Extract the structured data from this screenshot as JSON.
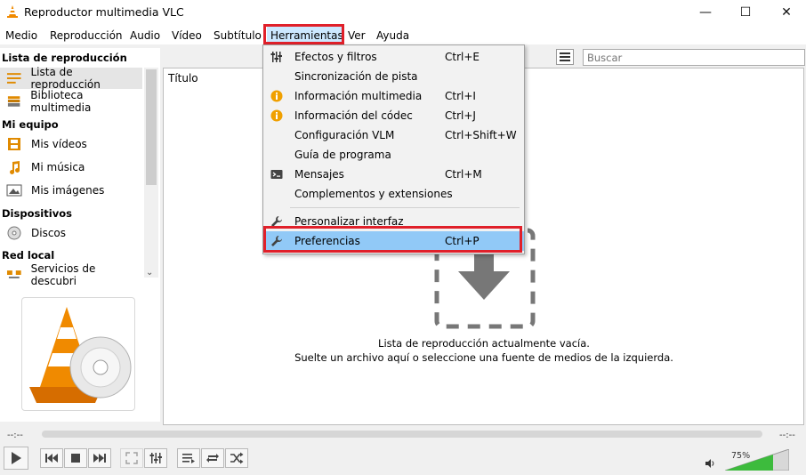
{
  "window": {
    "title": "Reproductor multimedia VLC",
    "minimize": "—",
    "maximize": "☐",
    "close": "✕"
  },
  "menubar": {
    "items": [
      "Medio",
      "Reproducción",
      "Audio",
      "Vídeo",
      "Subtítulo",
      "Herramientas",
      "Ver",
      "Ayuda"
    ],
    "active": "Herramientas"
  },
  "tools_menu": {
    "items": [
      {
        "label": "Efectos y filtros",
        "shortcut": "Ctrl+E",
        "icon": "sliders-icon"
      },
      {
        "label": "Sincronización de pista",
        "shortcut": "",
        "icon": ""
      },
      {
        "label": "Información multimedia",
        "shortcut": "Ctrl+I",
        "icon": "info-icon"
      },
      {
        "label": "Información del códec",
        "shortcut": "Ctrl+J",
        "icon": "info-icon"
      },
      {
        "label": "Configuración VLM",
        "shortcut": "Ctrl+Shift+W",
        "icon": ""
      },
      {
        "label": "Guía de programa",
        "shortcut": "",
        "icon": ""
      },
      {
        "label": "Mensajes",
        "shortcut": "Ctrl+M",
        "icon": "terminal-icon"
      },
      {
        "label": "Complementos y extensiones",
        "shortcut": "",
        "icon": ""
      },
      {
        "label": "Personalizar interfaz",
        "shortcut": "",
        "icon": "wrench-icon"
      },
      {
        "label": "Preferencias",
        "shortcut": "Ctrl+P",
        "icon": "wrench-icon"
      }
    ],
    "highlighted": "Preferencias"
  },
  "sidebar": {
    "sections": [
      {
        "header": "Lista de reproducción",
        "items": [
          "Lista de reproducción",
          "Biblioteca multimedia"
        ]
      },
      {
        "header": "Mi equipo",
        "items": [
          "Mis vídeos",
          "Mi música",
          "Mis imágenes"
        ]
      },
      {
        "header": "Dispositivos",
        "items": [
          "Discos"
        ]
      },
      {
        "header": "Red local",
        "items": [
          "Servicios de descubri"
        ]
      }
    ],
    "selected": "Lista de reproducción"
  },
  "playlist": {
    "column_title": "Título",
    "search_placeholder": "Buscar",
    "empty_line1": "Lista de reproducción actualmente vacía.",
    "empty_line2": "Suelte un archivo aquí o seleccione una fuente de medios de la izquierda."
  },
  "player": {
    "time_elapsed": "--:--",
    "time_total": "--:--",
    "volume_percent": "75%",
    "volume_level": 0.75
  },
  "colors": {
    "highlight_border": "#e0202a",
    "menu_selected": "#91c9f7",
    "vlc_orange": "#f08a00",
    "volume_green": "#3dbb3d"
  }
}
